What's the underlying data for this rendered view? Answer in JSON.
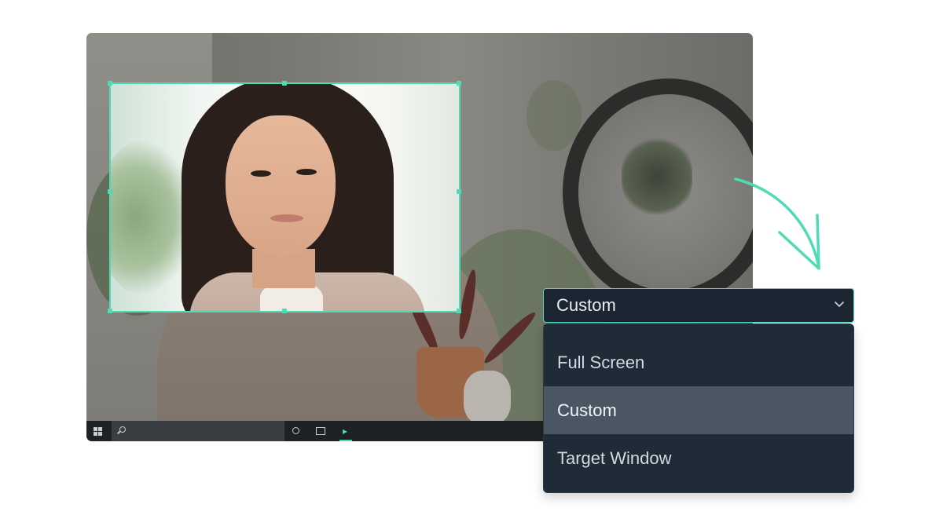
{
  "capture": {
    "accent_color": "#4fdbb6"
  },
  "taskbar": {
    "icons": [
      "windows-start-icon",
      "search-icon",
      "cortana-icon",
      "task-view-icon",
      "recorder-app-icon"
    ]
  },
  "dropdown": {
    "selected_value": "Custom",
    "options": [
      {
        "label": "Full Screen",
        "selected": false
      },
      {
        "label": "Custom",
        "selected": true
      },
      {
        "label": "Target Window",
        "selected": false
      }
    ],
    "background_color": "#1c2632",
    "highlight_color": "#4a5663"
  }
}
